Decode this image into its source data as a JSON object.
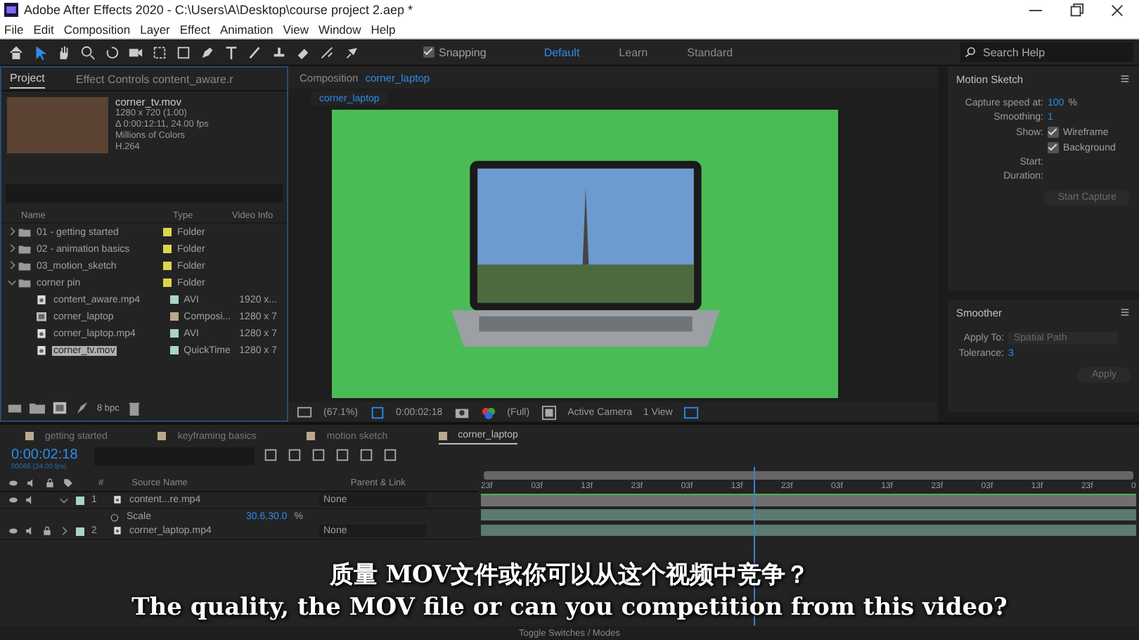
{
  "window": {
    "title": "Adobe After Effects 2020 - C:\\Users\\A\\Desktop\\course project 2.aep *"
  },
  "menu": [
    "File",
    "Edit",
    "Composition",
    "Layer",
    "Effect",
    "Animation",
    "View",
    "Window",
    "Help"
  ],
  "toolbar": {
    "snapping": {
      "label": "Snapping",
      "checked": true
    },
    "workspaces": [
      {
        "label": "Default",
        "selected": true
      },
      {
        "label": "Learn",
        "selected": false
      },
      {
        "label": "Standard",
        "selected": false
      }
    ],
    "search": {
      "placeholder": "Search Help"
    }
  },
  "project_panel": {
    "tabs": [
      {
        "label": "Project",
        "selected": true
      },
      {
        "label": "Effect Controls content_aware.r",
        "selected": false
      }
    ],
    "preview": {
      "name": "corner_tv.mov",
      "details": [
        "1280 x 720 (1.00)",
        "Δ 0:00:12:11, 24.00 fps",
        "Millions of Colors",
        "H.264"
      ]
    },
    "columns": [
      "Name",
      "Type",
      "Video Info"
    ],
    "items": [
      {
        "kind": "folder",
        "name": "01 - getting started",
        "type": "Folder",
        "color": "#e0d64a",
        "expanded": false,
        "selected": false
      },
      {
        "kind": "folder",
        "name": "02 - animation basics",
        "type": "Folder",
        "color": "#e0d64a",
        "expanded": false,
        "selected": false
      },
      {
        "kind": "folder",
        "name": "03_motion_sketch",
        "type": "Folder",
        "color": "#e0d64a",
        "expanded": false,
        "selected": false
      },
      {
        "kind": "folder",
        "name": "corner pin",
        "type": "Folder",
        "color": "#e0d64a",
        "expanded": true,
        "selected": false,
        "children": [
          {
            "kind": "footage",
            "name": "content_aware.mp4",
            "type": "AVI",
            "video_info": "1920 x...",
            "color": "#a9d3cb",
            "selected": false
          },
          {
            "kind": "comp",
            "name": "corner_laptop",
            "type": "Composi...",
            "video_info": "1280 x 7",
            "color": "#bba88c",
            "selected": false
          },
          {
            "kind": "footage",
            "name": "corner_laptop.mp4",
            "type": "AVI",
            "video_info": "1280 x 7",
            "color": "#a9d3cb",
            "selected": false
          },
          {
            "kind": "footage",
            "name": "corner_tv.mov",
            "type": "QuickTime",
            "video_info": "1280 x 7",
            "color": "#a9d3cb",
            "selected": true
          }
        ]
      }
    ],
    "bpc": "8 bpc"
  },
  "composition_panel": {
    "tab_prefix": "Composition",
    "tab_name": "corner_laptop",
    "view_tab": "corner_laptop",
    "footer": {
      "zoom": "(67.1%)",
      "time": "0:00:02:18",
      "resolution": "(Full)",
      "camera": "Active Camera",
      "views": "1 View"
    }
  },
  "motion_sketch": {
    "title": "Motion Sketch",
    "capture_speed_label": "Capture speed at:",
    "capture_speed": "100",
    "unit": "%",
    "smoothing_label": "Smoothing:",
    "smoothing": "1",
    "show_label": "Show:",
    "options": [
      {
        "label": "Wireframe",
        "checked": true
      },
      {
        "label": "Background",
        "checked": true
      }
    ],
    "start_label": "Start:",
    "duration_label": "Duration:",
    "button": {
      "label": "Start Capture",
      "disabled": true
    }
  },
  "smoother": {
    "title": "Smoother",
    "apply_to_label": "Apply To:",
    "apply_to": "Spatial Path",
    "tolerance_label": "Tolerance:",
    "tolerance": "3",
    "button": {
      "label": "Apply",
      "disabled": true
    }
  },
  "timeline": {
    "tabs": [
      {
        "label": "getting started",
        "selected": false
      },
      {
        "label": "keyframing basics",
        "selected": false
      },
      {
        "label": "motion sketch",
        "selected": false
      },
      {
        "label": "corner_laptop",
        "selected": true
      }
    ],
    "timecode": "0:00:02:18",
    "frame_info": "00066 (24.00 fps)",
    "columns": [
      "#",
      "Source Name",
      "Parent & Link"
    ],
    "ruler": [
      "23f",
      "03f",
      "13f",
      "23f",
      "03f",
      "13f",
      "23f",
      "03f",
      "13f",
      "23f",
      "03f",
      "13f",
      "23f",
      "0"
    ],
    "layers": [
      {
        "number": "1",
        "name": "content...re.mp4",
        "parent": "None",
        "expanded": true,
        "locked": false,
        "properties": [
          {
            "name": "Scale",
            "value": "30.6,30.0",
            "unit": "%"
          }
        ]
      },
      {
        "number": "2",
        "name": "corner_laptop.mp4",
        "parent": "None",
        "expanded": false,
        "locked": true
      }
    ],
    "toggle_label": "Toggle Switches / Modes"
  },
  "subtitles": [
    "质量 MOV文件或你可以从这个视频中竞争？",
    "The quality, the MOV file or can you competition from this video?"
  ]
}
